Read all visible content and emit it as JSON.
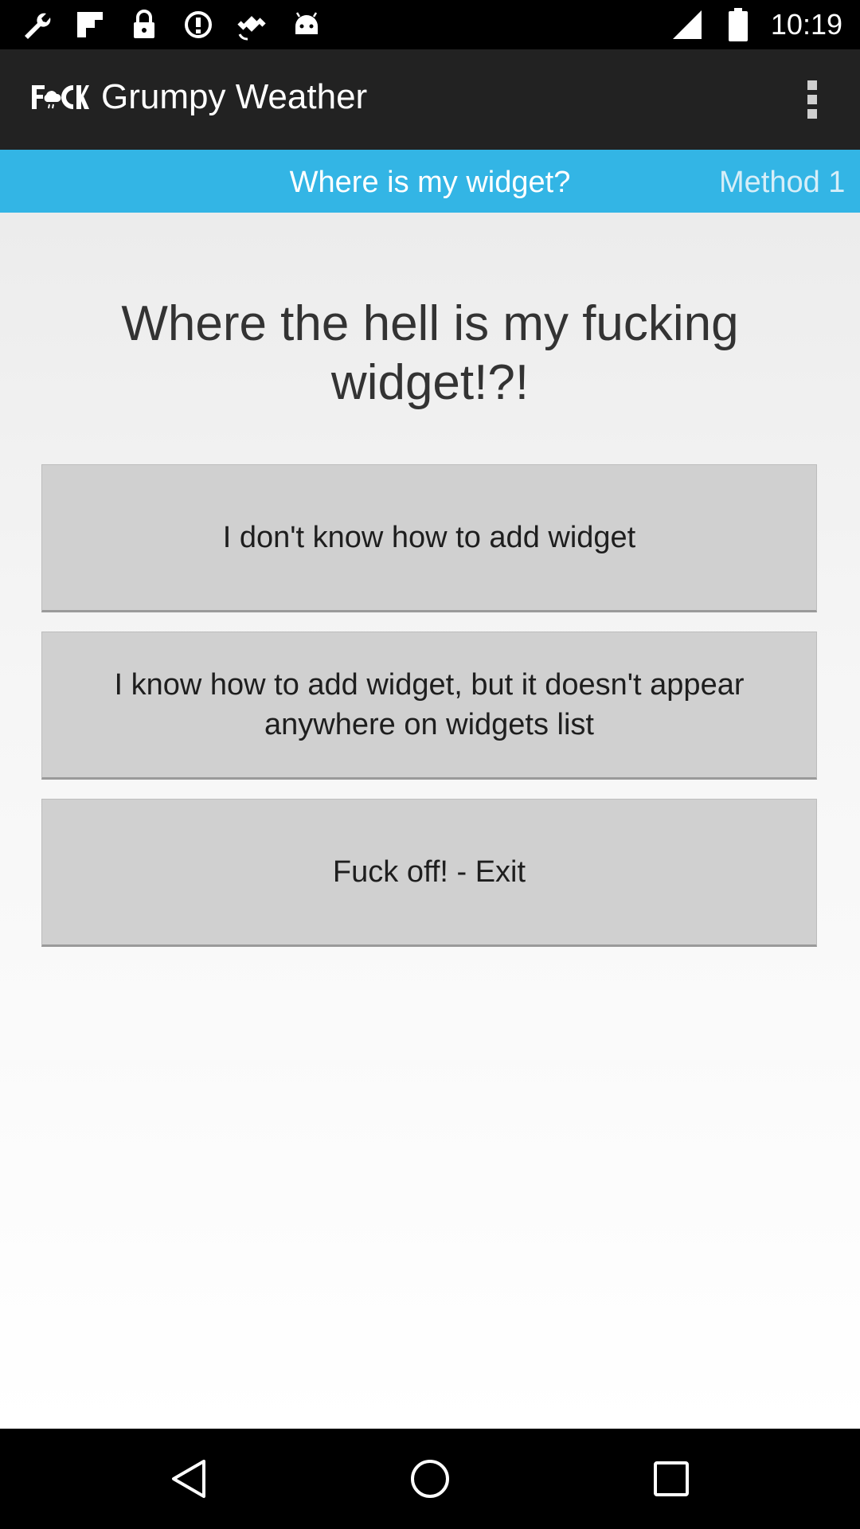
{
  "status_bar": {
    "time": "10:19",
    "icons": [
      "wrench-icon",
      "flipboard-icon",
      "lock-icon",
      "alert-icon",
      "fake-gps-icon",
      "android-icon",
      "signal-icon",
      "battery-icon"
    ]
  },
  "app_bar": {
    "logo_text": "F CK",
    "title": "Grumpy Weather",
    "overflow_icon": "more-vert-icon"
  },
  "tabs": {
    "active_label": "Where is my widget?",
    "next_label": "Method 1"
  },
  "main": {
    "heading": "Where the hell is my fucking widget!?!",
    "buttons": [
      "I don't know how to add widget",
      "I know how to add widget, but it doesn't appear anywhere on widgets list",
      "Fuck off! - Exit"
    ]
  },
  "nav_bar": {
    "icons": [
      "back-icon",
      "home-icon",
      "recents-icon"
    ]
  },
  "colors": {
    "status_bar": "#000000",
    "app_bar": "#222222",
    "tab_strip": "#33b5e5",
    "button_bg": "#d0d0d0"
  }
}
